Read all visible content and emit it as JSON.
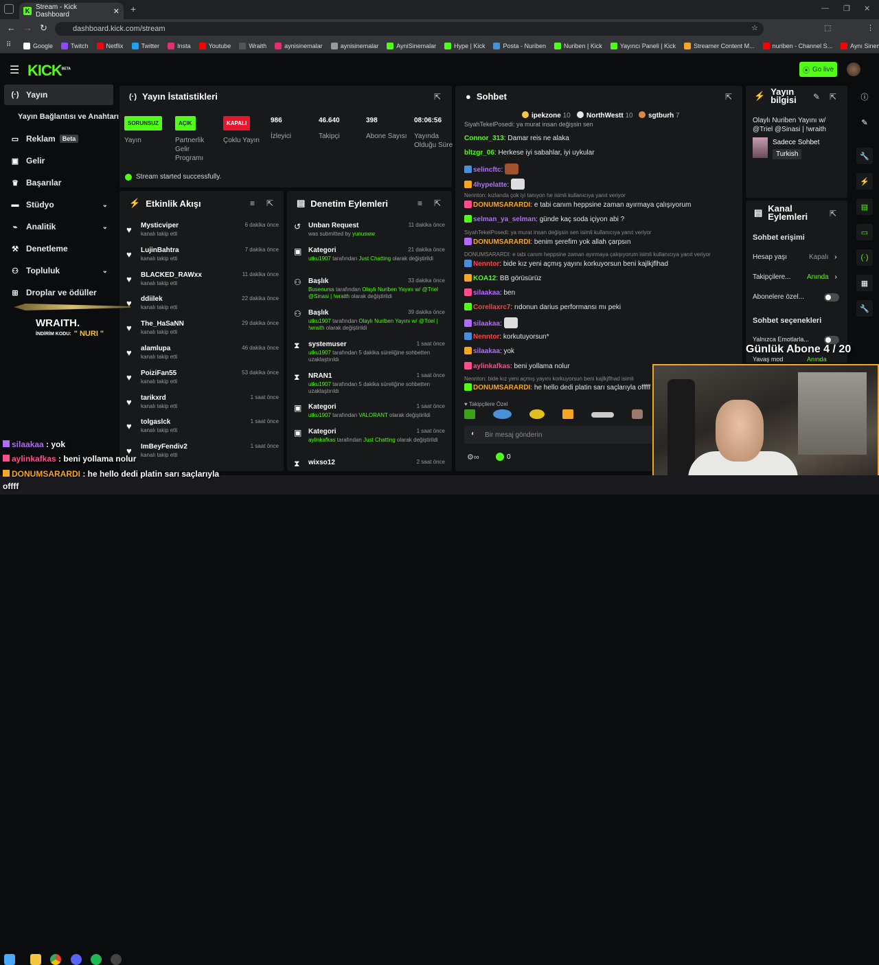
{
  "browser": {
    "tab_title": "Stream - Kick Dashboard",
    "url": "dashboard.kick.com/stream",
    "bookmarks": [
      "Google",
      "Twitch",
      "Netflix",
      "Twitter",
      "Insta",
      "Youtube",
      "Wraith",
      "aynisinemalar",
      "aynisinemalar",
      "AyniSinemalar",
      "Hype | Kick",
      "Posta - Nuriben",
      "Nuriben | Kick",
      "Yayıncı Paneli | Kick",
      "Streamer Content M...",
      "nuriben - Channel S...",
      "Aynı Sinemalar - Ça..."
    ]
  },
  "header": {
    "logo": "KICK",
    "logo_sup": "BETA",
    "go_live": "Go live"
  },
  "sidebar": {
    "items": [
      {
        "label": "Yayın",
        "icon": "broadcast-icon"
      },
      {
        "label": "Yayın Bağlantısı ve Anahtarı",
        "icon": ""
      },
      {
        "label": "Reklam",
        "icon": "ad-icon",
        "badge": "Beta"
      },
      {
        "label": "Gelir",
        "icon": "revenue-icon"
      },
      {
        "label": "Başarılar",
        "icon": "trophy-icon"
      },
      {
        "label": "Stüdyo",
        "icon": "studio-icon"
      },
      {
        "label": "Analitik",
        "icon": "analytics-icon"
      },
      {
        "label": "Denetleme",
        "icon": "moderation-icon"
      },
      {
        "label": "Topluluk",
        "icon": "community-icon"
      },
      {
        "label": "Droplar ve ödüller",
        "icon": "drops-icon"
      }
    ]
  },
  "stats": {
    "title": "Yayın İstatistikleri",
    "items": [
      {
        "badge": "SORUNSUZ",
        "label": "Yayın"
      },
      {
        "badge": "AÇIK",
        "label": "Partnerlik Gelir Programı"
      },
      {
        "badge": "KAPALI",
        "label": "Çoklu Yayın"
      },
      {
        "value": "986",
        "label": "İzleyici"
      },
      {
        "value": "46.640",
        "label": "Takipçi"
      },
      {
        "value": "398",
        "label": "Abone Sayısı"
      },
      {
        "value": "08:06:56",
        "label": "Yayında Olduğu Süre"
      }
    ],
    "success": "Stream started successfully."
  },
  "activity": {
    "title": "Etkinlik Akışı",
    "sub": "kanalı takip etti",
    "items": [
      {
        "name": "Mysticviper",
        "time": "6 dakika önce"
      },
      {
        "name": "LujinBahtra",
        "time": "7 dakika önce"
      },
      {
        "name": "BLACKED_RAWxx",
        "time": "11 dakika önce"
      },
      {
        "name": "ddiilek",
        "time": "22 dakika önce"
      },
      {
        "name": "The_HaSaNN",
        "time": "29 dakika önce"
      },
      {
        "name": "alamlupa",
        "time": "46 dakika önce"
      },
      {
        "name": "PoiziFan55",
        "time": "53 dakika önce"
      },
      {
        "name": "tarikxrd",
        "time": "1 saat önce"
      },
      {
        "name": "tolgaslck",
        "time": "1 saat önce"
      },
      {
        "name": "ImBeyFendiv2",
        "time": "1 saat önce"
      }
    ]
  },
  "moderation": {
    "title": "Denetim Eylemleri",
    "items": [
      {
        "title": "Unban Request",
        "time": "11 dakika önce",
        "d1": "was submitted by ",
        "g1": "yunusww",
        "d2": ""
      },
      {
        "title": "Kategori",
        "time": "21 dakika önce",
        "g0": "utku1907",
        "d1": " tarafından ",
        "g1": "Just Chatting",
        "d2": " olarak değiştirildi"
      },
      {
        "title": "Başlık",
        "time": "33 dakika önce",
        "g0": "Busenurss",
        "d1": " tarafından ",
        "g1": "Olaylı Nuriben Yayını w/ @Triel @Sinasi | !wraith",
        "d2": " olarak değiştirildi"
      },
      {
        "title": "Başlık",
        "time": "39 dakika önce",
        "g0": "utku1907",
        "d1": " tarafından ",
        "g1": "Olaylı Nuriben Yayını w/ @Triel | !wraith",
        "d2": " olarak değiştirildi"
      },
      {
        "title": "systemuser",
        "time": "1 saat önce",
        "g0": "utku1907",
        "d1": " tarafından 5 dakika süreliğine sohbetten uzaklaştırıldı",
        "g1": "",
        "d2": ""
      },
      {
        "title": "NRAN1",
        "time": "1 saat önce",
        "g0": "utku1907",
        "d1": " tarafından 5 dakika süreliğine sohbetten uzaklaştırıldı",
        "g1": "",
        "d2": ""
      },
      {
        "title": "Kategori",
        "time": "1 saat önce",
        "g0": "utku1907",
        "d1": " tarafından ",
        "g1": "VALORANT",
        "d2": " olarak değiştirildi"
      },
      {
        "title": "Kategori",
        "time": "1 saat önce",
        "g0": "aylinkafkas",
        "d1": " tarafından ",
        "g1": "Just Chatting",
        "d2": " olarak değiştirildi"
      },
      {
        "title": "wixso12",
        "time": "2 saat önce",
        "g0": "",
        "d1": "",
        "g1": "",
        "d2": ""
      }
    ]
  },
  "chat": {
    "title": "Sohbet",
    "top": [
      {
        "name": "ipekzone",
        "count": "10"
      },
      {
        "name": "NorthWestt",
        "count": "10"
      },
      {
        "name": "sgtburh",
        "count": "7"
      }
    ],
    "partial": "SiyahTekelPosedi: ya murat insan değişsin sen",
    "lines": [
      {
        "user": "Connor_313",
        "color": "#53fc18",
        "msg": "Damar reis ne alaka"
      },
      {
        "user": "bltzgr_06",
        "color": "#53fc18",
        "msg": "Herkese iyi sabahlar, iyi uykular"
      },
      {
        "user": "selincftc",
        "color": "#b16bff",
        "msg": ""
      },
      {
        "user": "4hypelatte",
        "color": "#b16bff",
        "msg": ""
      },
      {
        "user": "DONUMSARARDI",
        "color": "#f5a623",
        "msg": "e tabi canım heppsine zaman ayırmaya çalışıyorum"
      },
      {
        "user": "selman_ya_selman",
        "color": "#b16bff",
        "msg": "günde kaç soda içiyon abi ?"
      },
      {
        "user": "DONUMSARARDI",
        "color": "#f5a623",
        "msg": "benim şerefim yok allah çarpsın"
      },
      {
        "user": "Nenntor",
        "color": "#ff4444",
        "msg": "bide kız yeni açmış yayını korkuyorsun beni kajlkjflhad"
      },
      {
        "user": "KOA12",
        "color": "#53fc18",
        "msg": "BB görüsürüz"
      },
      {
        "user": "silaakaa",
        "color": "#b16bff",
        "msg": "ben"
      },
      {
        "user": "Corellaxrc7",
        "color": "#ff4444",
        "msg": "rıdonun darius performansı mı peki"
      },
      {
        "user": "silaakaa",
        "color": "#b16bff",
        "msg": ""
      },
      {
        "user": "Nenntor",
        "color": "#ff4444",
        "msg": "korkutuyorsun*"
      },
      {
        "user": "silaakaa",
        "color": "#b16bff",
        "msg": "yok"
      },
      {
        "user": "aylinkafkas",
        "color": "#ff4d8d",
        "msg": "beni yollama nolur"
      },
      {
        "user": "DONUMSARARDI",
        "color": "#f5a623",
        "msg": "he hello dedi platin sarı saçlarıyla offfff"
      }
    ],
    "replies": [
      "Nennton: kızlarıda çok iyi tanıyon he isimli kullanıcıya yanıt veriyor",
      "SiyahTekelPosedi: ya murat insan değişsin sen   isimli kullanıcıya yanıt veriyor",
      "DONUMSARARDI: e tabi canım heppsine zaman ayırmaya çalışıyorum isimli kullanıcıya yanıt veriyor",
      "Nennton: bide kız yeni açmış yayını korkuyorsun beni kajlkjflhad isimli"
    ],
    "follower_only": "Takipçilere Özel",
    "placeholder": "Bir mesaj gönderin",
    "points": "0"
  },
  "stream_info": {
    "title": "Yayın bilgisi",
    "stream_title": "Olaylı Nuriben Yayını w/ @Triel @Sinasi | !wraith",
    "category": "Sadece Sohbet",
    "language": "Turkish"
  },
  "channel_actions": {
    "title": "Kanal Eylemleri",
    "chat_access": "Sohbet erişimi",
    "account_age": "Hesap yaşı",
    "account_age_val": "Kapalı",
    "followers": "Takipçilere...",
    "followers_val": "Anında",
    "subs": "Abonelere özel...",
    "chat_options": "Sohbet seçenekleri",
    "emotes": "Yalnızca Emotlarla...",
    "slow": "Yavaş mod",
    "slow_val": "Anında"
  },
  "overlay": {
    "gunluk": "Günlük Abone 4 / 20",
    "wraith": "WRAITH.",
    "wraith_code_label": "İNDİRİM KODU:",
    "wraith_code": "\" NURI \"",
    "chat": [
      {
        "user": "silaakaa",
        "msg": " : yok",
        "color": "#b16bff"
      },
      {
        "user": "aylinkafkas",
        "msg": " : beni yollama nolur",
        "color": "#ff4d8d"
      },
      {
        "user": "DONUMSARARDI",
        "msg": " : he hello dedi platin sarı saçlarıyla",
        "color": "#f5a623"
      }
    ],
    "chat_cont": "offff"
  }
}
